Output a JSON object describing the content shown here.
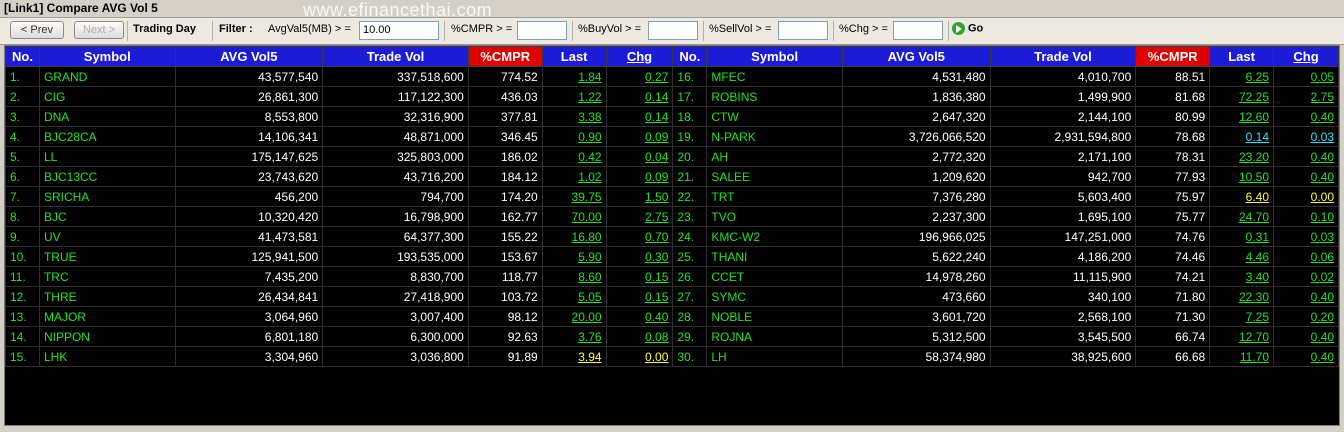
{
  "window": {
    "title": "[Link1] Compare AVG Vol 5"
  },
  "watermark": "www.efinancethai.com",
  "toolbar": {
    "prev_label": "< Prev",
    "next_label": "Next >",
    "trading_day_label": "Trading Day",
    "filter_label": "Filter :",
    "avgvol_label": "AvgVal5(MB) > =",
    "avgvol_value": "10.00",
    "cmpr_label": "%CMPR > =",
    "cmpr_value": "",
    "buyvol_label": "%BuyVol > =",
    "buyvol_value": "",
    "sellvol_label": "%SellVol > =",
    "sellvol_value": "",
    "chg_label": "%Chg > =",
    "chg_value": "",
    "go_label": "Go"
  },
  "columns": [
    "No.",
    "Symbol",
    "AVG Vol5",
    "Trade Vol",
    "%CMPR",
    "Last",
    "Chg"
  ],
  "colors": {
    "up": "#1fe51f",
    "unchanged": "#ffff30",
    "ceiling": "#22e8ff",
    "header": "#1c1cd6",
    "cmpr_header": "#e00000"
  },
  "rows_left": [
    {
      "no": "1.",
      "symbol": "GRAND",
      "avg": "43,577,540",
      "trade": "337,518,600",
      "cmpr": "774.52",
      "last": "1.84",
      "chg": "0.27",
      "status": "up"
    },
    {
      "no": "2.",
      "symbol": "CIG",
      "avg": "26,861,300",
      "trade": "117,122,300",
      "cmpr": "436.03",
      "last": "1.22",
      "chg": "0.14",
      "status": "up"
    },
    {
      "no": "3.",
      "symbol": "DNA",
      "avg": "8,553,800",
      "trade": "32,316,900",
      "cmpr": "377.81",
      "last": "3.38",
      "chg": "0.14",
      "status": "up"
    },
    {
      "no": "4.",
      "symbol": "BJC28CA",
      "avg": "14,106,341",
      "trade": "48,871,000",
      "cmpr": "346.45",
      "last": "0.90",
      "chg": "0.09",
      "status": "up"
    },
    {
      "no": "5.",
      "symbol": "LL",
      "avg": "175,147,625",
      "trade": "325,803,000",
      "cmpr": "186.02",
      "last": "0.42",
      "chg": "0.04",
      "status": "up"
    },
    {
      "no": "6.",
      "symbol": "BJC13CC",
      "avg": "23,743,620",
      "trade": "43,716,200",
      "cmpr": "184.12",
      "last": "1.02",
      "chg": "0.09",
      "status": "up"
    },
    {
      "no": "7.",
      "symbol": "SRICHA",
      "avg": "456,200",
      "trade": "794,700",
      "cmpr": "174.20",
      "last": "39.75",
      "chg": "1.50",
      "status": "up"
    },
    {
      "no": "8.",
      "symbol": "BJC",
      "avg": "10,320,420",
      "trade": "16,798,900",
      "cmpr": "162.77",
      "last": "70.00",
      "chg": "2.75",
      "status": "up"
    },
    {
      "no": "9.",
      "symbol": "UV",
      "avg": "41,473,581",
      "trade": "64,377,300",
      "cmpr": "155.22",
      "last": "16.80",
      "chg": "0.70",
      "status": "up"
    },
    {
      "no": "10.",
      "symbol": "TRUE",
      "avg": "125,941,500",
      "trade": "193,535,000",
      "cmpr": "153.67",
      "last": "5.90",
      "chg": "0.30",
      "status": "up"
    },
    {
      "no": "11.",
      "symbol": "TRC",
      "avg": "7,435,200",
      "trade": "8,830,700",
      "cmpr": "118.77",
      "last": "8.60",
      "chg": "0.15",
      "status": "up"
    },
    {
      "no": "12.",
      "symbol": "THRE",
      "avg": "26,434,841",
      "trade": "27,418,900",
      "cmpr": "103.72",
      "last": "5.05",
      "chg": "0.15",
      "status": "up"
    },
    {
      "no": "13.",
      "symbol": "MAJOR",
      "avg": "3,064,960",
      "trade": "3,007,400",
      "cmpr": "98.12",
      "last": "20.00",
      "chg": "0.40",
      "status": "up"
    },
    {
      "no": "14.",
      "symbol": "NIPPON",
      "avg": "6,801,180",
      "trade": "6,300,000",
      "cmpr": "92.63",
      "last": "3.76",
      "chg": "0.08",
      "status": "up"
    },
    {
      "no": "15.",
      "symbol": "LHK",
      "avg": "3,304,960",
      "trade": "3,036,800",
      "cmpr": "91.89",
      "last": "3.94",
      "chg": "0.00",
      "status": "unchanged"
    }
  ],
  "rows_right": [
    {
      "no": "16.",
      "symbol": "MFEC",
      "avg": "4,531,480",
      "trade": "4,010,700",
      "cmpr": "88.51",
      "last": "6.25",
      "chg": "0.05",
      "status": "up"
    },
    {
      "no": "17.",
      "symbol": "ROBINS",
      "avg": "1,836,380",
      "trade": "1,499,900",
      "cmpr": "81.68",
      "last": "72.25",
      "chg": "2.75",
      "status": "up"
    },
    {
      "no": "18.",
      "symbol": "CTW",
      "avg": "2,647,320",
      "trade": "2,144,100",
      "cmpr": "80.99",
      "last": "12.60",
      "chg": "0.40",
      "status": "up"
    },
    {
      "no": "19.",
      "symbol": "N-PARK",
      "avg": "3,726,066,520",
      "trade": "2,931,594,800",
      "cmpr": "78.68",
      "last": "0.14",
      "chg": "0.03",
      "status": "ceiling"
    },
    {
      "no": "20.",
      "symbol": "AH",
      "avg": "2,772,320",
      "trade": "2,171,100",
      "cmpr": "78.31",
      "last": "23.20",
      "chg": "0.40",
      "status": "up"
    },
    {
      "no": "21.",
      "symbol": "SALEE",
      "avg": "1,209,620",
      "trade": "942,700",
      "cmpr": "77.93",
      "last": "10.50",
      "chg": "0.40",
      "status": "up"
    },
    {
      "no": "22.",
      "symbol": "TRT",
      "avg": "7,376,280",
      "trade": "5,603,400",
      "cmpr": "75.97",
      "last": "6.40",
      "chg": "0.00",
      "status": "unchanged"
    },
    {
      "no": "23.",
      "symbol": "TVO",
      "avg": "2,237,300",
      "trade": "1,695,100",
      "cmpr": "75.77",
      "last": "24.70",
      "chg": "0.10",
      "status": "up"
    },
    {
      "no": "24.",
      "symbol": "KMC-W2",
      "avg": "196,966,025",
      "trade": "147,251,000",
      "cmpr": "74.76",
      "last": "0.31",
      "chg": "0.03",
      "status": "up"
    },
    {
      "no": "25.",
      "symbol": "THANI",
      "avg": "5,622,240",
      "trade": "4,186,200",
      "cmpr": "74.46",
      "last": "4.46",
      "chg": "0.06",
      "status": "up"
    },
    {
      "no": "26.",
      "symbol": "CCET",
      "avg": "14,978,260",
      "trade": "11,115,900",
      "cmpr": "74.21",
      "last": "3.40",
      "chg": "0.02",
      "status": "up"
    },
    {
      "no": "27.",
      "symbol": "SYMC",
      "avg": "473,660",
      "trade": "340,100",
      "cmpr": "71.80",
      "last": "22.30",
      "chg": "0.40",
      "status": "up"
    },
    {
      "no": "28.",
      "symbol": "NOBLE",
      "avg": "3,601,720",
      "trade": "2,568,100",
      "cmpr": "71.30",
      "last": "7.25",
      "chg": "0.20",
      "status": "up"
    },
    {
      "no": "29.",
      "symbol": "ROJNA",
      "avg": "5,312,500",
      "trade": "3,545,500",
      "cmpr": "66.74",
      "last": "12.70",
      "chg": "0.40",
      "status": "up"
    },
    {
      "no": "30.",
      "symbol": "LH",
      "avg": "58,374,980",
      "trade": "38,925,600",
      "cmpr": "66.68",
      "last": "11.70",
      "chg": "0.40",
      "status": "up"
    }
  ]
}
